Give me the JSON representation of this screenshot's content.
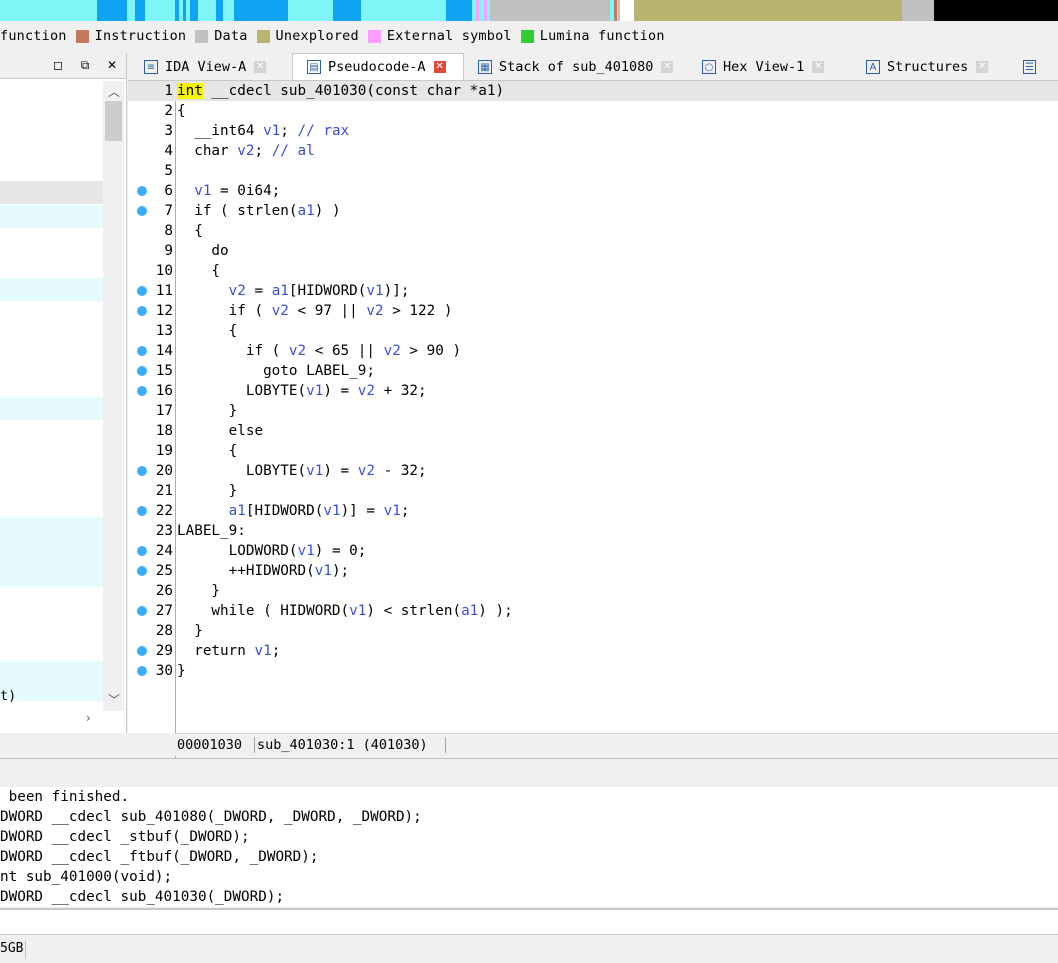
{
  "colors": {
    "navband_bg": "#7ff5f7",
    "library_function": "#0fa3f4",
    "instruction": "#c27a5f",
    "data": "#c0c0c0",
    "unexplored": "#b9b46f",
    "external_symbol": "#ff9cff",
    "lumina_function": "#33cc33",
    "breakpoint_dot": "#3aaefc",
    "variable_blue": "#3a4ed1",
    "highlight_yellow": "#f4f400",
    "close_red": "#e04a3a"
  },
  "legend": [
    {
      "label": "function",
      "color": ""
    },
    {
      "label": "Instruction",
      "color": "#c27a5f"
    },
    {
      "label": "Data",
      "color": "#c0c0c0"
    },
    {
      "label": "Unexplored",
      "color": "#b9b46f"
    },
    {
      "label": "External symbol",
      "color": "#ff9cff"
    },
    {
      "label": "Lumina function",
      "color": "#33cc33"
    }
  ],
  "left_panel": {
    "header_buttons": [
      "◻",
      "⧉",
      "✕"
    ],
    "truncated_text": "t)"
  },
  "tabs": [
    {
      "label": "IDA View-A",
      "icon": "disasm-icon",
      "active": false
    },
    {
      "label": "Pseudocode-A",
      "icon": "pseudocode-icon",
      "active": true
    },
    {
      "label": "Stack of sub_401080",
      "icon": "stack-icon",
      "active": false
    },
    {
      "label": "Hex View-1",
      "icon": "hex-icon",
      "active": false
    },
    {
      "label": "Structures",
      "icon": "structures-icon",
      "active": false
    }
  ],
  "code": {
    "lines": [
      {
        "n": "1",
        "bp": false,
        "text": " __cdecl sub_401030(const char *a1)"
      },
      {
        "n": "2",
        "bp": false,
        "text": "{"
      },
      {
        "n": "3",
        "bp": false,
        "text": "  __int64 v1; // rax"
      },
      {
        "n": "4",
        "bp": false,
        "text": "  char v2; // al"
      },
      {
        "n": "5",
        "bp": false,
        "text": ""
      },
      {
        "n": "6",
        "bp": true,
        "text": "  v1 = 0i64;"
      },
      {
        "n": "7",
        "bp": true,
        "text": "  if ( strlen(a1) )"
      },
      {
        "n": "8",
        "bp": false,
        "text": "  {"
      },
      {
        "n": "9",
        "bp": false,
        "text": "    do"
      },
      {
        "n": "10",
        "bp": false,
        "text": "    {"
      },
      {
        "n": "11",
        "bp": true,
        "text": "      v2 = a1[HIDWORD(v1)];"
      },
      {
        "n": "12",
        "bp": true,
        "text": "      if ( v2 < 97 || v2 > 122 )"
      },
      {
        "n": "13",
        "bp": false,
        "text": "      {"
      },
      {
        "n": "14",
        "bp": true,
        "text": "        if ( v2 < 65 || v2 > 90 )"
      },
      {
        "n": "15",
        "bp": true,
        "text": "          goto LABEL_9;"
      },
      {
        "n": "16",
        "bp": true,
        "text": "        LOBYTE(v1) = v2 + 32;"
      },
      {
        "n": "17",
        "bp": false,
        "text": "      }"
      },
      {
        "n": "18",
        "bp": false,
        "text": "      else"
      },
      {
        "n": "19",
        "bp": false,
        "text": "      {"
      },
      {
        "n": "20",
        "bp": true,
        "text": "        LOBYTE(v1) = v2 - 32;"
      },
      {
        "n": "21",
        "bp": false,
        "text": "      }"
      },
      {
        "n": "22",
        "bp": true,
        "text": "      a1[HIDWORD(v1)] = v1;"
      },
      {
        "n": "23",
        "bp": false,
        "text": "LABEL_9:"
      },
      {
        "n": "24",
        "bp": true,
        "text": "      LODWORD(v1) = 0;"
      },
      {
        "n": "25",
        "bp": true,
        "text": "      ++HIDWORD(v1);"
      },
      {
        "n": "26",
        "bp": false,
        "text": "    }"
      },
      {
        "n": "27",
        "bp": true,
        "text": "    while ( HIDWORD(v1) < strlen(a1) );"
      },
      {
        "n": "28",
        "bp": false,
        "text": "  }"
      },
      {
        "n": "29",
        "bp": true,
        "text": "  return v1;"
      },
      {
        "n": "30",
        "bp": true,
        "text": "}"
      }
    ],
    "first_keyword": "int"
  },
  "status": {
    "address": "00001030",
    "location": "sub_401030:1 (401030)"
  },
  "output": [
    " been finished.",
    "DWORD __cdecl sub_401080(_DWORD, _DWORD, _DWORD);",
    "DWORD __cdecl _stbuf(_DWORD);",
    "DWORD __cdecl _ftbuf(_DWORD, _DWORD);",
    "nt sub_401000(void);",
    "DWORD __cdecl sub_401030(_DWORD);"
  ],
  "statusbar": {
    "text": "5GB"
  }
}
